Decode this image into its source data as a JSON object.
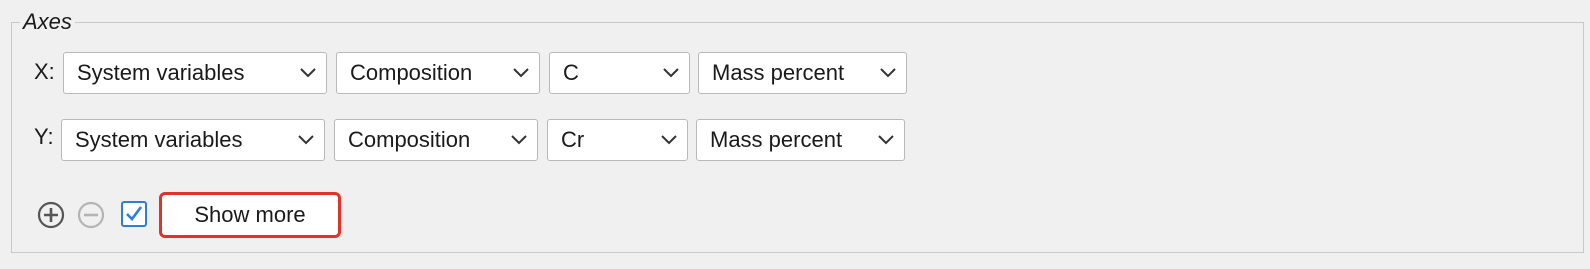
{
  "group": {
    "title": "Axes"
  },
  "axes": [
    {
      "label": "X:",
      "category": "System variables",
      "quantity": "Composition",
      "element": "C",
      "unit": "Mass percent"
    },
    {
      "label": "Y:",
      "category": "System variables",
      "quantity": "Composition",
      "element": "Cr",
      "unit": "Mass percent"
    }
  ],
  "controls": {
    "add_icon": "plus-circle-icon",
    "remove_icon": "minus-circle-icon",
    "checkbox_checked": true,
    "show_more_label": "Show more"
  },
  "colors": {
    "highlight": "#e0342a",
    "checkbox_accent": "#2c7fd6"
  }
}
